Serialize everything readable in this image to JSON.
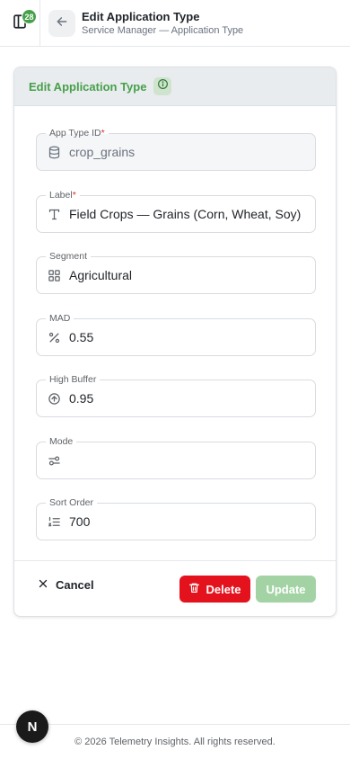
{
  "header": {
    "notification_count": "28",
    "title": "Edit Application Type",
    "subtitle": "Service Manager — Application Type"
  },
  "card": {
    "title": "Edit Application Type"
  },
  "fields": [
    {
      "label": "App Type ID",
      "required": "*",
      "value": "crop_grains",
      "icon": "database-icon",
      "disabled": true
    },
    {
      "label": "Label",
      "required": "*",
      "value": "Field Crops — Grains (Corn, Wheat, Soy)",
      "icon": "text-type-icon",
      "disabled": false
    },
    {
      "label": "Segment",
      "value": "Agricultural",
      "icon": "grid-icon",
      "disabled": false
    },
    {
      "label": "MAD",
      "value": "0.55",
      "icon": "percent-icon",
      "disabled": false
    },
    {
      "label": "High Buffer",
      "value": "0.95",
      "icon": "arrow-up-circle-icon",
      "disabled": false
    },
    {
      "label": "Mode",
      "value": "",
      "icon": "sliders-icon",
      "disabled": false
    },
    {
      "label": "Sort Order",
      "value": "700",
      "icon": "ordered-list-icon",
      "disabled": false
    }
  ],
  "actions": {
    "cancel_label": "Cancel",
    "delete_label": "Delete",
    "update_label": "Update"
  },
  "footer": {
    "next_badge": "N",
    "copyright": "© 2026 Telemetry Insights. All rights reserved."
  },
  "colors": {
    "accent": "#45a04a",
    "danger": "#e3121d",
    "update_disabled": "#a3d3a5"
  }
}
